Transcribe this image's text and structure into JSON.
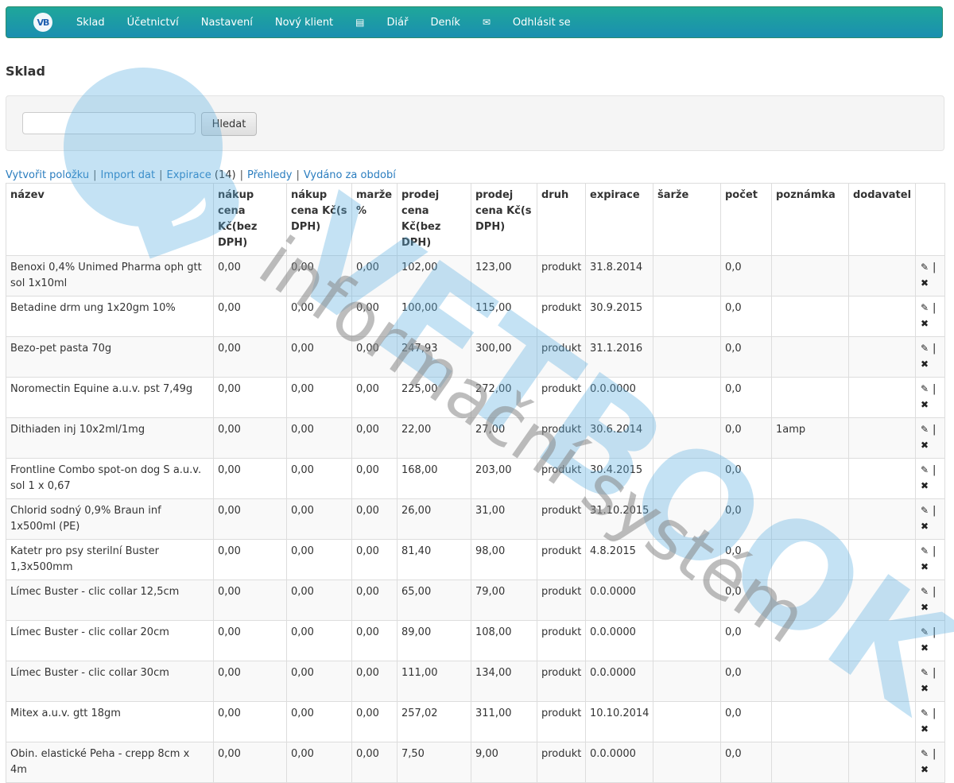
{
  "nav": {
    "brand": "VB",
    "items": [
      "Sklad",
      "Účetnictví",
      "Nastavení",
      "Nový klient",
      "Diář",
      "Deník",
      "Odhlásit se"
    ],
    "icons": [
      "list-icon",
      "envelope-icon"
    ]
  },
  "page": {
    "title": "Sklad"
  },
  "search": {
    "value": "",
    "placeholder": "",
    "button": "Hledat"
  },
  "links": {
    "create": "Vytvořit položku",
    "import": "Import dat",
    "expirace": "Expirace",
    "expirace_count": "(14)",
    "prehledy": "Přehledy",
    "vydano": "Vydáno za období",
    "separator": "|"
  },
  "table": {
    "columns": [
      "název",
      "nákup cena Kč(bez DPH)",
      "nákup cena Kč(s DPH)",
      "marže %",
      "prodej cena Kč(bez DPH)",
      "prodej cena Kč(s DPH)",
      "druh",
      "expirace",
      "šarže",
      "počet",
      "poznámka",
      "dodavatel",
      ""
    ],
    "rows": [
      {
        "nazev": "Benoxi 0,4% Unimed Pharma oph gtt sol 1x10ml",
        "nakup_bez": "0,00",
        "nakup_s": "0,00",
        "marze": "0,00",
        "prodej_bez": "102,00",
        "prodej_s": "123,00",
        "druh": "produkt",
        "expirace": "31.8.2014",
        "sarze": "",
        "pocet": "0,0",
        "poznamka": "",
        "dodavatel": ""
      },
      {
        "nazev": "Betadine drm ung 1x20gm 10%",
        "nakup_bez": "0,00",
        "nakup_s": "0,00",
        "marze": "0,00",
        "prodej_bez": "100,00",
        "prodej_s": "115,00",
        "druh": "produkt",
        "expirace": "30.9.2015",
        "sarze": "",
        "pocet": "0,0",
        "poznamka": "",
        "dodavatel": ""
      },
      {
        "nazev": "Bezo-pet pasta 70g",
        "nakup_bez": "0,00",
        "nakup_s": "0,00",
        "marze": "0,00",
        "prodej_bez": "247,93",
        "prodej_s": "300,00",
        "druh": "produkt",
        "expirace": "31.1.2016",
        "sarze": "",
        "pocet": "0,0",
        "poznamka": "",
        "dodavatel": ""
      },
      {
        "nazev": "Noromectin Equine a.u.v. pst 7,49g",
        "nakup_bez": "0,00",
        "nakup_s": "0,00",
        "marze": "0,00",
        "prodej_bez": "225,00",
        "prodej_s": "272,00",
        "druh": "produkt",
        "expirace": "0.0.0000",
        "sarze": "",
        "pocet": "0,0",
        "poznamka": "",
        "dodavatel": ""
      },
      {
        "nazev": "Dithiaden inj 10x2ml/1mg",
        "nakup_bez": "0,00",
        "nakup_s": "0,00",
        "marze": "0,00",
        "prodej_bez": "22,00",
        "prodej_s": "27,00",
        "druh": "produkt",
        "expirace": "30.6.2014",
        "sarze": "",
        "pocet": "0,0",
        "poznamka": "1amp",
        "dodavatel": ""
      },
      {
        "nazev": "Frontline Combo spot-on dog S a.u.v. sol 1 x 0,67",
        "nakup_bez": "0,00",
        "nakup_s": "0,00",
        "marze": "0,00",
        "prodej_bez": "168,00",
        "prodej_s": "203,00",
        "druh": "produkt",
        "expirace": "30.4.2015",
        "sarze": "",
        "pocet": "0,0",
        "poznamka": "",
        "dodavatel": ""
      },
      {
        "nazev": "Chlorid sodný 0,9% Braun inf 1x500ml (PE)",
        "nakup_bez": "0,00",
        "nakup_s": "0,00",
        "marze": "0,00",
        "prodej_bez": "26,00",
        "prodej_s": "31,00",
        "druh": "produkt",
        "expirace": "31.10.2015",
        "sarze": "",
        "pocet": "0,0",
        "poznamka": "",
        "dodavatel": ""
      },
      {
        "nazev": "Katetr pro psy sterilní Buster 1,3x500mm",
        "nakup_bez": "0,00",
        "nakup_s": "0,00",
        "marze": "0,00",
        "prodej_bez": "81,40",
        "prodej_s": "98,00",
        "druh": "produkt",
        "expirace": "4.8.2015",
        "sarze": "",
        "pocet": "0,0",
        "poznamka": "",
        "dodavatel": ""
      },
      {
        "nazev": "Límec Buster - clic collar 12,5cm",
        "nakup_bez": "0,00",
        "nakup_s": "0,00",
        "marze": "0,00",
        "prodej_bez": "65,00",
        "prodej_s": "79,00",
        "druh": "produkt",
        "expirace": "0.0.0000",
        "sarze": "",
        "pocet": "0,0",
        "poznamka": "",
        "dodavatel": ""
      },
      {
        "nazev": "Límec Buster - clic collar 20cm",
        "nakup_bez": "0,00",
        "nakup_s": "0,00",
        "marze": "0,00",
        "prodej_bez": "89,00",
        "prodej_s": "108,00",
        "druh": "produkt",
        "expirace": "0.0.0000",
        "sarze": "",
        "pocet": "0,0",
        "poznamka": "",
        "dodavatel": ""
      },
      {
        "nazev": "Límec Buster - clic collar 30cm",
        "nakup_bez": "0,00",
        "nakup_s": "0,00",
        "marze": "0,00",
        "prodej_bez": "111,00",
        "prodej_s": "134,00",
        "druh": "produkt",
        "expirace": "0.0.0000",
        "sarze": "",
        "pocet": "0,0",
        "poznamka": "",
        "dodavatel": ""
      },
      {
        "nazev": "Mitex a.u.v. gtt 18gm",
        "nakup_bez": "0,00",
        "nakup_s": "0,00",
        "marze": "0,00",
        "prodej_bez": "257,02",
        "prodej_s": "311,00",
        "druh": "produkt",
        "expirace": "10.10.2014",
        "sarze": "",
        "pocet": "0,0",
        "poznamka": "",
        "dodavatel": ""
      },
      {
        "nazev": "Obin. elastické Peha - crepp 8cm x 4m",
        "nakup_bez": "0,00",
        "nakup_s": "0,00",
        "marze": "0,00",
        "prodej_bez": "7,50",
        "prodej_s": "9,00",
        "druh": "produkt",
        "expirace": "0.0.0000",
        "sarze": "",
        "pocet": "0,0",
        "poznamka": "",
        "dodavatel": ""
      }
    ],
    "action_icons": [
      "edit-icon",
      "delete-icon"
    ],
    "action_separator": "|"
  },
  "watermark": {
    "logo": "VETBOOK",
    "tagline": "informační systém"
  },
  "colors": {
    "nav_top": "#1fa79a",
    "nav_bottom": "#1a8fb0",
    "link": "#2a7dbf",
    "wm_blue": "#5aaee0",
    "wm_orange": "#f08a6a",
    "wm_gray": "#888888"
  }
}
